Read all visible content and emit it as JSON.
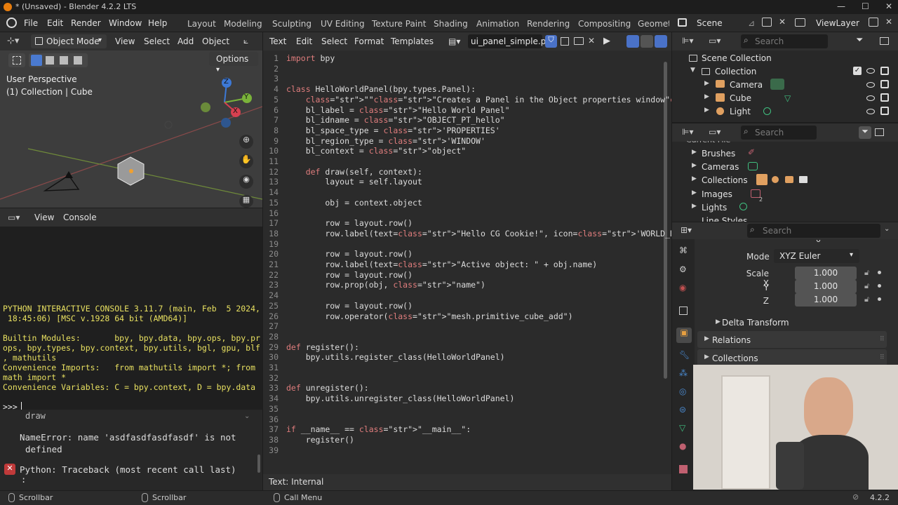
{
  "window": {
    "title": "* (Unsaved) - Blender 4.2.2 LTS"
  },
  "topbar": {
    "menus": [
      "File",
      "Edit",
      "Render",
      "Window",
      "Help"
    ],
    "workspaces": [
      "Layout",
      "Modeling",
      "Sculpting",
      "UV Editing",
      "Texture Paint",
      "Shading",
      "Animation",
      "Rendering",
      "Compositing",
      "Geometr"
    ],
    "scene": "Scene",
    "view_layer": "ViewLayer"
  },
  "viewport": {
    "mode": "Object Mode",
    "menus": [
      "View",
      "Select",
      "Add",
      "Object"
    ],
    "options": "Options",
    "perspective": "User Perspective",
    "collection_info": "(1) Collection | Cube",
    "axes": {
      "z": "Z",
      "y": "Y",
      "x": "X"
    }
  },
  "console": {
    "menus": [
      "View",
      "Console"
    ],
    "lines": [
      "PYTHON INTERACTIVE CONSOLE 3.11.7 (main, Feb  5 2024,",
      " 18:45:06) [MSC v.1928 64 bit (AMD64)]",
      "",
      "Builtin Modules:       bpy, bpy.data, bpy.ops, bpy.pr",
      "ops, bpy.types, bpy.context, bpy.utils, bgl, gpu, blf",
      ", mathutils",
      "Convenience Imports:   from mathutils import *; from",
      "math import *",
      "Convenience Variables: C = bpy.context, D = bpy.data"
    ],
    "prompt": ">>> ",
    "error_partial": "draw",
    "error_lines": [
      "NameError: name 'asdfasdfasdfasdf' is not",
      "defined"
    ],
    "traceback": "Python: Traceback (most recent call last)",
    "traceback2": ":"
  },
  "text_editor": {
    "menus": [
      "Text",
      "Edit",
      "Select",
      "Format",
      "Templates"
    ],
    "filename": "ui_panel_simple.py",
    "status": "Text: Internal",
    "line_numbers": [
      "1",
      "2",
      "3",
      "4",
      "5",
      "6",
      "7",
      "8",
      "9",
      "10",
      "11",
      "12",
      "13",
      "14",
      "15",
      "16",
      "17",
      "18",
      "19",
      "20",
      "21",
      "22",
      "23",
      "24",
      "25",
      "26",
      "27",
      "28",
      "29",
      "30",
      "31",
      "32",
      "33",
      "34",
      "35",
      "36",
      "37",
      "38",
      "39"
    ],
    "code": [
      "import bpy",
      "",
      "",
      "class HelloWorldPanel(bpy.types.Panel):",
      "    \"\"\"Creates a Panel in the Object properties window\"\"\"",
      "    bl_label = \"Hello World Panel\"",
      "    bl_idname = \"OBJECT_PT_hello\"",
      "    bl_space_type = 'PROPERTIES'",
      "    bl_region_type = 'WINDOW'",
      "    bl_context = \"object\"",
      "",
      "    def draw(self, context):",
      "        layout = self.layout",
      "",
      "        obj = context.object",
      "        ",
      "        row = layout.row()",
      "        row.label(text=\"Hello CG Cookie!\", icon='WORLD_DATA')",
      "",
      "        row = layout.row()",
      "        row.label(text=\"Active object: \" + obj.name)",
      "        row = layout.row()",
      "        row.prop(obj, \"name\")",
      "",
      "        row = layout.row()",
      "        row.operator(\"mesh.primitive_cube_add\")",
      "",
      "",
      "def register():",
      "    bpy.utils.register_class(HelloWorldPanel)",
      "",
      "",
      "def unregister():",
      "    bpy.utils.unregister_class(HelloWorldPanel)",
      "",
      "",
      "if __name__ == \"__main__\":",
      "    register()",
      ""
    ]
  },
  "outliner": {
    "search_placeholder": "Search",
    "items": [
      "Scene Collection",
      "Collection",
      "Camera",
      "Cube",
      "Light"
    ]
  },
  "blendfile": {
    "search_placeholder": "Search",
    "header_partial": "Current File",
    "items": [
      "Brushes",
      "Cameras",
      "Collections",
      "Images",
      "Lights",
      "Line Styles"
    ],
    "images_count": "2"
  },
  "properties": {
    "search_placeholder": "Search",
    "z_partial": "0°",
    "mode_label": "Mode",
    "mode_value": "XYZ Euler",
    "scale": [
      {
        "label": "Scale X",
        "value": "1.000"
      },
      {
        "label": "Y",
        "value": "1.000"
      },
      {
        "label": "Z",
        "value": "1.000"
      }
    ],
    "sections": [
      "Delta Transform",
      "Relations",
      "Collections"
    ]
  },
  "statusbar": {
    "items": [
      "Scrollbar",
      "Scrollbar",
      "Call Menu"
    ],
    "version": "4.2.2"
  }
}
